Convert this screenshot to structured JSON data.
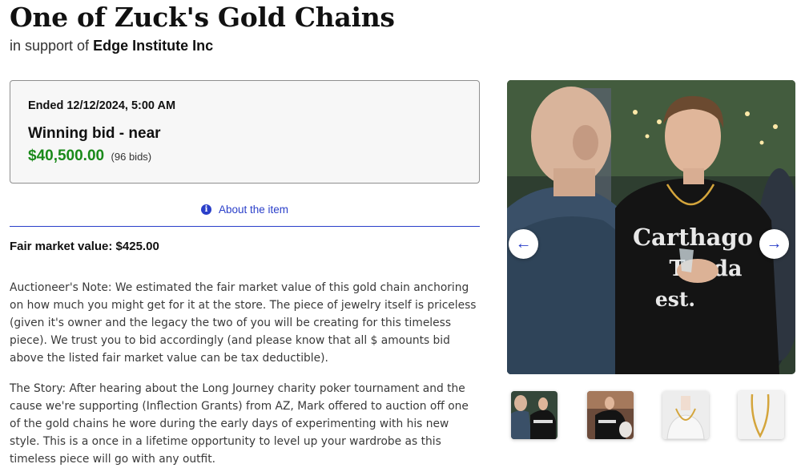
{
  "item": {
    "title": "One of Zuck's Gold Chains",
    "support_prefix": "in support of",
    "organization": "Edge Institute Inc"
  },
  "auction": {
    "ended": "Ended 12/12/2024, 5:00 AM",
    "winning_label": "Winning bid - near",
    "amount": "$40,500.00",
    "bids": "(96 bids)"
  },
  "tabs": {
    "about_label": "About the item",
    "about_icon": "info-icon"
  },
  "details": {
    "fair_market_value": "Fair market value: $425.00",
    "auctioneer_note": "Auctioneer's Note: We estimated the fair market value of this gold chain anchoring on how much you might get for it at the store. The piece of jewelry itself is priceless (given it's owner and the legacy the two of you will be creating for this timeless piece). We trust you to bid accordingly (and please know that all $ amounts bid above the listed fair market value can be tax deductible).",
    "story": "The Story: After hearing about the Long Journey charity poker tournament and the cause we're supporting (Inflection Grants) from AZ, Mark offered to auction off one of the gold chains he wore during the early days of experimenting with his new style. This is a once in a lifetime opportunity to level up your wardrobe as this timeless piece will go with any outfit."
  },
  "gallery": {
    "prev_icon": "arrow-left-icon",
    "next_icon": "arrow-right-icon",
    "prev_glyph": "←",
    "next_glyph": "→",
    "shirt_text": [
      "Carthago",
      "Tonda",
      "est."
    ]
  },
  "colors": {
    "accent": "#2a3fc9",
    "price": "#1a8a1a",
    "gold": "#d4a53c"
  }
}
